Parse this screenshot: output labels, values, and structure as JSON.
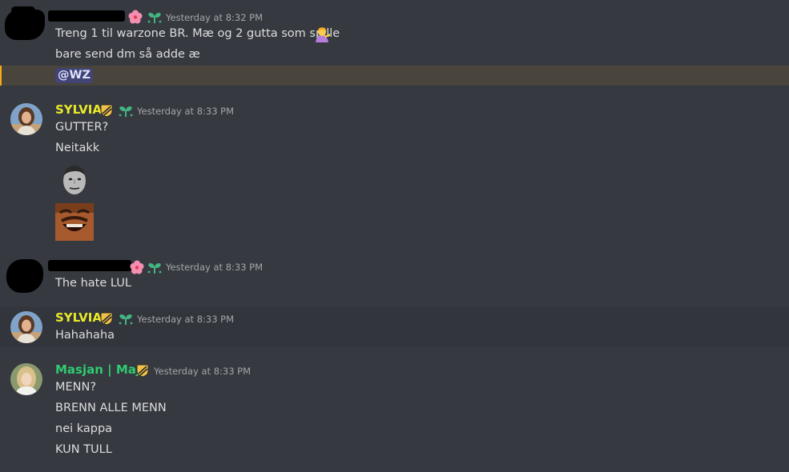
{
  "colors": {
    "background": "#36393f",
    "mention_highlight": "#49443c",
    "sylvia_name": "#e9e92b",
    "maja_name": "#2ecc71",
    "timestamp": "#a3a6aa"
  },
  "messages": [
    {
      "author": "",
      "timestamp": "Yesterday at 8:32 PM",
      "lines": [
        "Treng 1 til warzone BR. Mæ og 2 gutta som spille",
        "bare send dm så adde æ"
      ],
      "mention": "@WZ",
      "emoji_trailing": "person-tipping-hand-emoji"
    },
    {
      "author": "SYLVIA",
      "timestamp": "Yesterday at 8:33 PM",
      "lines": [
        "GUTTER?",
        "Neitakk"
      ],
      "emotes": [
        "kappa-emote",
        "laughing-face-emote"
      ]
    },
    {
      "author": "",
      "timestamp": "Yesterday at 8:33 PM",
      "lines": [
        "The hate LUL"
      ]
    },
    {
      "author": "SYLVIA",
      "timestamp": "Yesterday at 8:33 PM",
      "lines": [
        "Hahahaha"
      ]
    },
    {
      "author": "Masjan | Maja",
      "timestamp": "Yesterday at 8:33 PM",
      "lines": [
        "MENN?",
        "BRENN ALLE MENN",
        "nei kappa",
        "KUN TULL"
      ]
    }
  ]
}
